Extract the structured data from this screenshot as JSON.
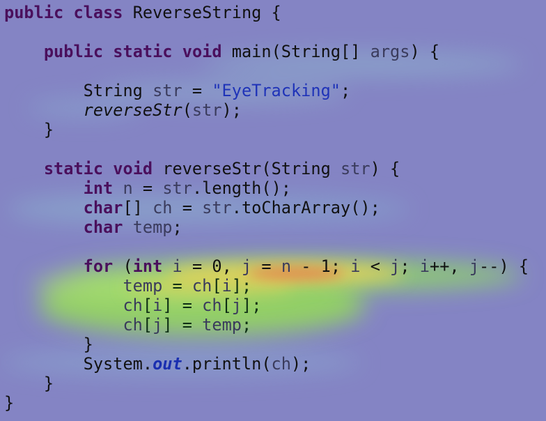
{
  "editor": {
    "file_class": "ReverseString",
    "colors": {
      "background": "#8484c4",
      "keyword": "#4a0f5c",
      "string": "#1f33b8",
      "variable": "#3a3b5c",
      "field": "#1a2fb0"
    },
    "lines": [
      [
        {
          "t": "public",
          "c": "kw"
        },
        {
          "t": " ",
          "c": "plain"
        },
        {
          "t": "class",
          "c": "kw"
        },
        {
          "t": " ReverseString {",
          "c": "plain"
        }
      ],
      [],
      [
        {
          "t": "    ",
          "c": "plain"
        },
        {
          "t": "public",
          "c": "kw"
        },
        {
          "t": " ",
          "c": "plain"
        },
        {
          "t": "static",
          "c": "kw"
        },
        {
          "t": " ",
          "c": "plain"
        },
        {
          "t": "void",
          "c": "kw"
        },
        {
          "t": " main(String[] ",
          "c": "plain"
        },
        {
          "t": "args",
          "c": "var"
        },
        {
          "t": ") {",
          "c": "plain"
        }
      ],
      [],
      [
        {
          "t": "        String ",
          "c": "plain"
        },
        {
          "t": "str",
          "c": "var"
        },
        {
          "t": " = ",
          "c": "plain"
        },
        {
          "t": "\"EyeTracking\"",
          "c": "str"
        },
        {
          "t": ";",
          "c": "plain"
        }
      ],
      [
        {
          "t": "        ",
          "c": "plain"
        },
        {
          "t": "reverseStr",
          "c": "italic"
        },
        {
          "t": "(",
          "c": "plain"
        },
        {
          "t": "str",
          "c": "var"
        },
        {
          "t": ");",
          "c": "plain"
        }
      ],
      [
        {
          "t": "    }",
          "c": "plain"
        }
      ],
      [],
      [
        {
          "t": "    ",
          "c": "plain"
        },
        {
          "t": "static",
          "c": "kw"
        },
        {
          "t": " ",
          "c": "plain"
        },
        {
          "t": "void",
          "c": "kw"
        },
        {
          "t": " reverseStr(String ",
          "c": "plain"
        },
        {
          "t": "str",
          "c": "var"
        },
        {
          "t": ") {",
          "c": "plain"
        }
      ],
      [
        {
          "t": "        ",
          "c": "plain"
        },
        {
          "t": "int",
          "c": "kw"
        },
        {
          "t": " ",
          "c": "plain"
        },
        {
          "t": "n",
          "c": "var"
        },
        {
          "t": " = ",
          "c": "plain"
        },
        {
          "t": "str",
          "c": "var"
        },
        {
          "t": ".length();",
          "c": "plain"
        }
      ],
      [
        {
          "t": "        ",
          "c": "plain"
        },
        {
          "t": "char",
          "c": "kw"
        },
        {
          "t": "[] ",
          "c": "plain"
        },
        {
          "t": "ch",
          "c": "var"
        },
        {
          "t": " = ",
          "c": "plain"
        },
        {
          "t": "str",
          "c": "var"
        },
        {
          "t": ".toCharArray();",
          "c": "plain"
        }
      ],
      [
        {
          "t": "        ",
          "c": "plain"
        },
        {
          "t": "char",
          "c": "kw"
        },
        {
          "t": " ",
          "c": "plain"
        },
        {
          "t": "temp",
          "c": "var"
        },
        {
          "t": ";",
          "c": "plain"
        }
      ],
      [],
      [
        {
          "t": "        ",
          "c": "plain"
        },
        {
          "t": "for",
          "c": "kw"
        },
        {
          "t": " (",
          "c": "plain"
        },
        {
          "t": "int",
          "c": "kw"
        },
        {
          "t": " ",
          "c": "plain"
        },
        {
          "t": "i",
          "c": "var"
        },
        {
          "t": " = 0, ",
          "c": "plain"
        },
        {
          "t": "j",
          "c": "var"
        },
        {
          "t": " = ",
          "c": "plain"
        },
        {
          "t": "n",
          "c": "var"
        },
        {
          "t": " - 1; ",
          "c": "plain"
        },
        {
          "t": "i",
          "c": "var"
        },
        {
          "t": " < ",
          "c": "plain"
        },
        {
          "t": "j",
          "c": "var"
        },
        {
          "t": "; ",
          "c": "plain"
        },
        {
          "t": "i",
          "c": "var"
        },
        {
          "t": "++, ",
          "c": "plain"
        },
        {
          "t": "j",
          "c": "var"
        },
        {
          "t": "--) {",
          "c": "plain"
        }
      ],
      [
        {
          "t": "            ",
          "c": "plain"
        },
        {
          "t": "temp",
          "c": "var"
        },
        {
          "t": " = ",
          "c": "dark"
        },
        {
          "t": "ch",
          "c": "var"
        },
        {
          "t": "[",
          "c": "dark"
        },
        {
          "t": "i",
          "c": "var"
        },
        {
          "t": "];",
          "c": "dark"
        }
      ],
      [
        {
          "t": "            ",
          "c": "plain"
        },
        {
          "t": "ch",
          "c": "var"
        },
        {
          "t": "[",
          "c": "dark"
        },
        {
          "t": "i",
          "c": "var"
        },
        {
          "t": "] = ",
          "c": "dark"
        },
        {
          "t": "ch",
          "c": "var"
        },
        {
          "t": "[",
          "c": "dark"
        },
        {
          "t": "j",
          "c": "var"
        },
        {
          "t": "];",
          "c": "dark"
        }
      ],
      [
        {
          "t": "            ",
          "c": "plain"
        },
        {
          "t": "ch",
          "c": "var"
        },
        {
          "t": "[",
          "c": "dark"
        },
        {
          "t": "j",
          "c": "var"
        },
        {
          "t": "] = ",
          "c": "dark"
        },
        {
          "t": "temp",
          "c": "var"
        },
        {
          "t": ";",
          "c": "dark"
        }
      ],
      [
        {
          "t": "        }",
          "c": "plain"
        }
      ],
      [
        {
          "t": "        System.",
          "c": "plain"
        },
        {
          "t": "out",
          "c": "field"
        },
        {
          "t": ".println(",
          "c": "plain"
        },
        {
          "t": "ch",
          "c": "var"
        },
        {
          "t": ");",
          "c": "plain"
        }
      ],
      [
        {
          "t": "    }",
          "c": "plain"
        }
      ],
      [
        {
          "t": "}",
          "c": "plain"
        }
      ]
    ]
  }
}
